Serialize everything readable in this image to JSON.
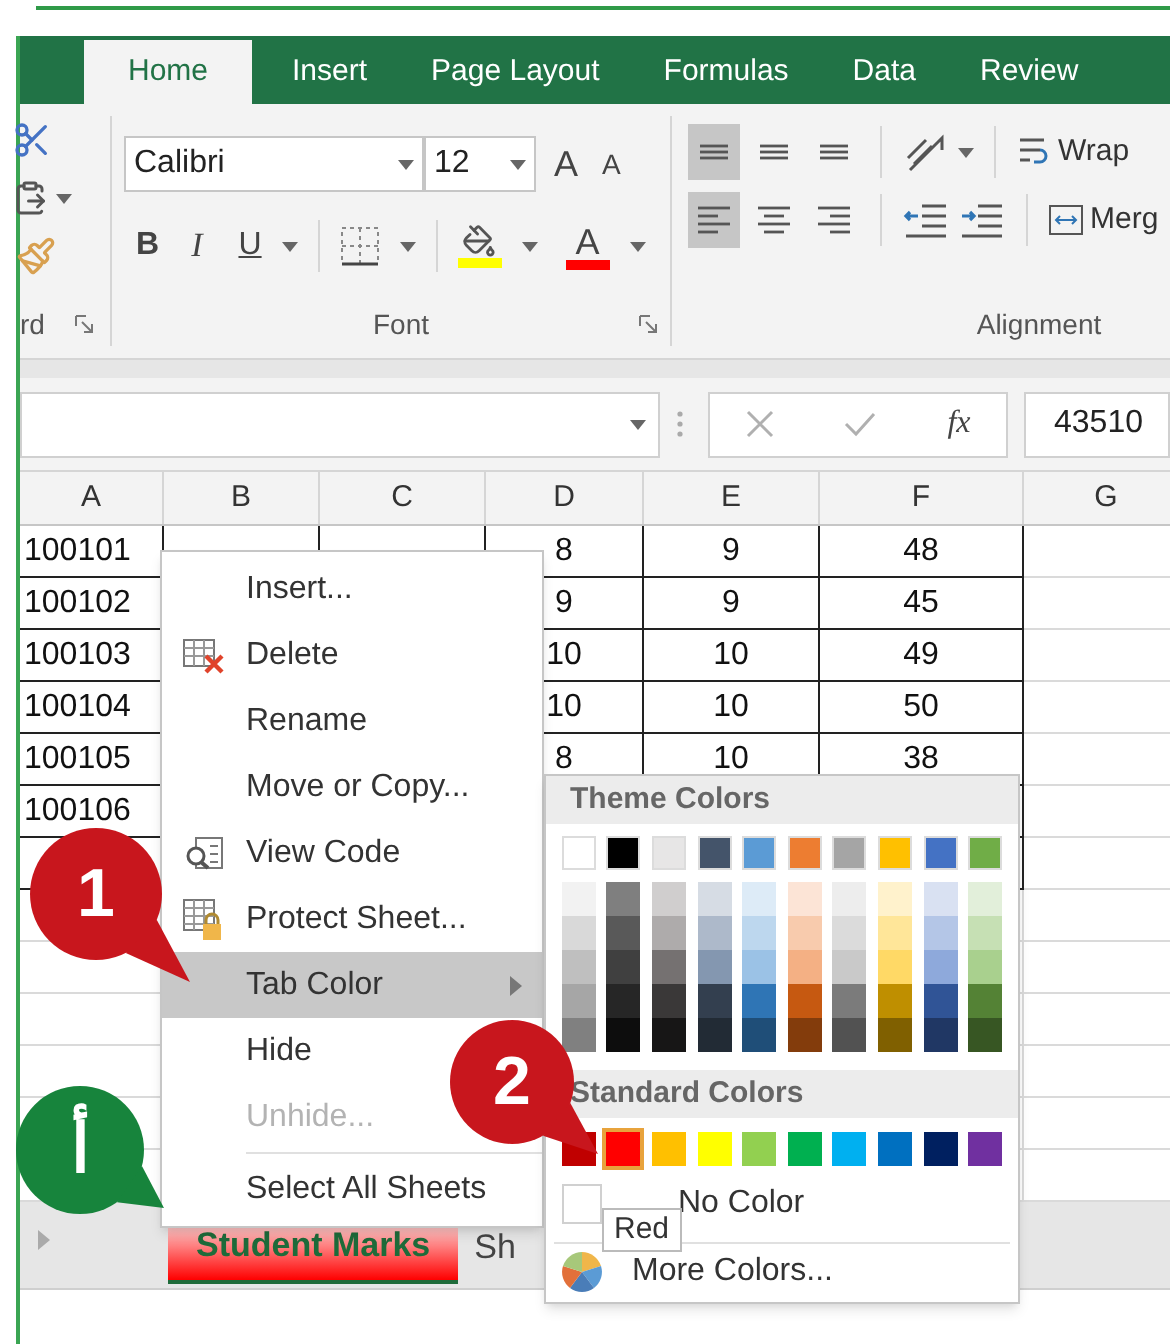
{
  "ribbon_tabs": [
    {
      "label": "Home",
      "selected": true
    },
    {
      "label": "Insert",
      "selected": false
    },
    {
      "label": "Page Layout",
      "selected": false
    },
    {
      "label": "Formulas",
      "selected": false
    },
    {
      "label": "Data",
      "selected": false
    },
    {
      "label": "Review",
      "selected": false
    }
  ],
  "clipboard": {
    "label": "rd"
  },
  "font_group": {
    "label": "Font",
    "font_name": "Calibri",
    "font_size": "12",
    "grow_label": "A",
    "shrink_label": "A",
    "bold_label": "B",
    "italic_label": "I",
    "underline_label": "U",
    "fill": {
      "color": "#ffff00"
    },
    "font_color_label": "A",
    "font_color": {
      "color": "#ff0000"
    }
  },
  "alignment_group": {
    "label": "Alignment",
    "vertical": [
      {
        "selected": true
      },
      {
        "selected": false
      },
      {
        "selected": false
      }
    ],
    "horizontal": [
      {
        "selected": true
      },
      {
        "selected": false
      },
      {
        "selected": false
      }
    ],
    "wrap_label": "Wrap",
    "merge_label": "Merg"
  },
  "formula_bar": {
    "function_label": "fx",
    "value": "43510"
  },
  "columns": [
    "A",
    "B",
    "C",
    "D",
    "E",
    "F",
    "G"
  ],
  "rows": [
    {
      "cells": [
        "100101",
        null,
        null,
        "8",
        "9",
        "48",
        null
      ]
    },
    {
      "cells": [
        "100102",
        null,
        null,
        "9",
        "9",
        "45",
        null
      ]
    },
    {
      "cells": [
        "100103",
        null,
        null,
        "10",
        "10",
        "49",
        null
      ]
    },
    {
      "cells": [
        "100104",
        null,
        null,
        "10",
        "10",
        "50",
        null
      ]
    },
    {
      "cells": [
        "100105",
        null,
        null,
        "8",
        "10",
        "38",
        null
      ]
    },
    {
      "cells": [
        "100106",
        null,
        null,
        null,
        null,
        null,
        null
      ]
    }
  ],
  "context_menu": {
    "items": [
      {
        "kind": "item",
        "label": "Insert...",
        "selected": false,
        "disabled": false,
        "submenu": false
      },
      {
        "kind": "item",
        "label": "Delete",
        "selected": false,
        "disabled": false,
        "submenu": false
      },
      {
        "kind": "item",
        "label": "Rename",
        "selected": false,
        "disabled": false,
        "submenu": false
      },
      {
        "kind": "item",
        "label": "Move or Copy...",
        "selected": false,
        "disabled": false,
        "submenu": false
      },
      {
        "kind": "item",
        "label": "View Code",
        "selected": false,
        "disabled": false,
        "submenu": false
      },
      {
        "kind": "item",
        "label": "Protect Sheet...",
        "selected": false,
        "disabled": false,
        "submenu": false
      },
      {
        "kind": "item",
        "label": "Tab Color",
        "selected": true,
        "disabled": false,
        "submenu": true
      },
      {
        "kind": "item",
        "label": "Hide",
        "selected": false,
        "disabled": false,
        "submenu": false
      },
      {
        "kind": "item",
        "label": "Unhide...",
        "selected": false,
        "disabled": true,
        "submenu": false
      },
      {
        "kind": "separator"
      },
      {
        "kind": "item",
        "label": "Select All Sheets",
        "selected": false,
        "disabled": false,
        "submenu": false
      }
    ]
  },
  "color_menu": {
    "theme_title": "Theme Colors",
    "theme_colors": [
      {
        "color": "#ffffff"
      },
      {
        "color": "#000000"
      },
      {
        "color": "#e7e6e6"
      },
      {
        "color": "#44546a"
      },
      {
        "color": "#5b9bd5"
      },
      {
        "color": "#ed7d31"
      },
      {
        "color": "#a5a5a5"
      },
      {
        "color": "#ffc000"
      },
      {
        "color": "#4472c4"
      },
      {
        "color": "#70ad47"
      }
    ],
    "theme_shades": [
      {
        "shades": [
          {
            "color": "#f2f2f2"
          },
          {
            "color": "#d9d9d9"
          },
          {
            "color": "#bfbfbf"
          },
          {
            "color": "#a6a6a6"
          },
          {
            "color": "#808080"
          }
        ]
      },
      {
        "shades": [
          {
            "color": "#7f7f7f"
          },
          {
            "color": "#595959"
          },
          {
            "color": "#404040"
          },
          {
            "color": "#262626"
          },
          {
            "color": "#0d0d0d"
          }
        ]
      },
      {
        "shades": [
          {
            "color": "#d0cece"
          },
          {
            "color": "#aeabab"
          },
          {
            "color": "#757171"
          },
          {
            "color": "#3a3838"
          },
          {
            "color": "#171616"
          }
        ]
      },
      {
        "shades": [
          {
            "color": "#d6dce4"
          },
          {
            "color": "#adb9ca"
          },
          {
            "color": "#8497b0"
          },
          {
            "color": "#333f4f"
          },
          {
            "color": "#222b35"
          }
        ]
      },
      {
        "shades": [
          {
            "color": "#ddebf7"
          },
          {
            "color": "#bdd7ee"
          },
          {
            "color": "#9bc2e6"
          },
          {
            "color": "#2f75b5"
          },
          {
            "color": "#1f4e78"
          }
        ]
      },
      {
        "shades": [
          {
            "color": "#fce4d6"
          },
          {
            "color": "#f8cbad"
          },
          {
            "color": "#f4b084"
          },
          {
            "color": "#c65911"
          },
          {
            "color": "#833c0c"
          }
        ]
      },
      {
        "shades": [
          {
            "color": "#ededed"
          },
          {
            "color": "#dbdbdb"
          },
          {
            "color": "#c9c9c9"
          },
          {
            "color": "#7b7b7b"
          },
          {
            "color": "#525252"
          }
        ]
      },
      {
        "shades": [
          {
            "color": "#fff2cc"
          },
          {
            "color": "#ffe699"
          },
          {
            "color": "#ffd966"
          },
          {
            "color": "#bf8f00"
          },
          {
            "color": "#806000"
          }
        ]
      },
      {
        "shades": [
          {
            "color": "#d9e1f2"
          },
          {
            "color": "#b4c6e7"
          },
          {
            "color": "#8ea9db"
          },
          {
            "color": "#305496"
          },
          {
            "color": "#203764"
          }
        ]
      },
      {
        "shades": [
          {
            "color": "#e2efda"
          },
          {
            "color": "#c6e0b4"
          },
          {
            "color": "#a9d08e"
          },
          {
            "color": "#548235"
          },
          {
            "color": "#375623"
          }
        ]
      }
    ],
    "standard_title": "Standard Colors",
    "standard_colors": [
      {
        "color": "#c00000",
        "selected": false
      },
      {
        "color": "#ff0000",
        "selected": true
      },
      {
        "color": "#ffc000",
        "selected": false
      },
      {
        "color": "#ffff00",
        "selected": false
      },
      {
        "color": "#92d050",
        "selected": false
      },
      {
        "color": "#00b050",
        "selected": false
      },
      {
        "color": "#00b0f0",
        "selected": false
      },
      {
        "color": "#0070c0",
        "selected": false
      },
      {
        "color": "#002060",
        "selected": false
      },
      {
        "color": "#7030a0",
        "selected": false
      }
    ],
    "no_color_label": "No Color",
    "tooltip": "Red",
    "more_colors_label": "More Colors..."
  },
  "sheet_tabs": [
    {
      "label": "Student Marks",
      "selected": true,
      "color": "#ff0000"
    },
    {
      "label": "Sh",
      "selected": false
    }
  ],
  "callouts": [
    {
      "label": "1",
      "color": "#c8161d"
    },
    {
      "label": "2",
      "color": "#c8161d"
    },
    {
      "label": "أ",
      "color": "#17843c"
    }
  ]
}
